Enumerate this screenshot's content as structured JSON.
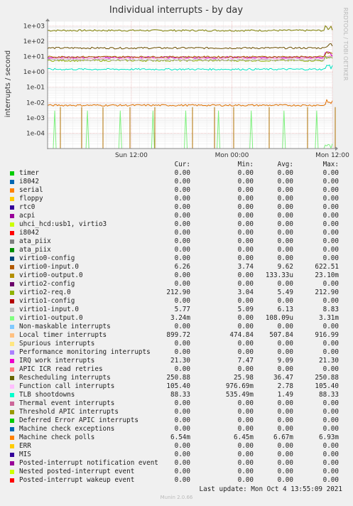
{
  "chart_data": {
    "type": "line",
    "title": "Individual interrupts - by day",
    "ylabel": "interrupts / second",
    "side_label": "RRDTOOL / TOBI OETIKER",
    "y_scale": "log",
    "ylim": [
      1e-05,
      2000
    ],
    "y_ticks": [
      "1e+03",
      "1e+02",
      "1e+01",
      "1e+00",
      "1e-01",
      "1e-02",
      "1e-03",
      "1e-04"
    ],
    "x_ticks": [
      "Sun 12:00",
      "Mon 00:00",
      "Mon 12:00"
    ],
    "grid": true,
    "series_shown": [
      {
        "name": "Local timer interrupts",
        "color": "#7e7e00",
        "value": 507.84
      },
      {
        "name": "Function call interrupts",
        "color": "#ff8fd3",
        "value": 7.78
      },
      {
        "name": "Rescheduling interrupts",
        "color": "#6b4e00",
        "value": 36.47
      },
      {
        "name": "IRQ work interrupts",
        "color": "#c000c0",
        "value": 9.09
      },
      {
        "name": "virtio2-req.0",
        "color": "#8fb000",
        "value": 5.49
      },
      {
        "name": "virtio1-input.0",
        "color": "#b0b0b0",
        "value": 6.13
      },
      {
        "name": "TLB shootdowns",
        "color": "#00e0c0",
        "value": 1.49
      },
      {
        "name": "Machine check polls",
        "color": "#e07000",
        "value": 0.00667
      },
      {
        "name": "virtio0-input.0",
        "color": "#b07000",
        "value": 9.62
      },
      {
        "name": "virtio1-output.0",
        "color": "#7ef07e",
        "value": 0.000108
      }
    ]
  },
  "legend": {
    "headers": {
      "cur": "Cur:",
      "min": "Min:",
      "avg": "Avg:",
      "max": "Max:"
    },
    "rows": [
      {
        "name": "timer",
        "color": "#00cc00",
        "cur": "0.00",
        "min": "0.00",
        "avg": "0.00",
        "max": "0.00"
      },
      {
        "name": "i8042",
        "color": "#0066b3",
        "cur": "0.00",
        "min": "0.00",
        "avg": "0.00",
        "max": "0.00"
      },
      {
        "name": "serial",
        "color": "#ff8000",
        "cur": "0.00",
        "min": "0.00",
        "avg": "0.00",
        "max": "0.00"
      },
      {
        "name": "floppy",
        "color": "#ffcc00",
        "cur": "0.00",
        "min": "0.00",
        "avg": "0.00",
        "max": "0.00"
      },
      {
        "name": "rtc0",
        "color": "#330099",
        "cur": "0.00",
        "min": "0.00",
        "avg": "0.00",
        "max": "0.00"
      },
      {
        "name": "acpi",
        "color": "#990099",
        "cur": "0.00",
        "min": "0.00",
        "avg": "0.00",
        "max": "0.00"
      },
      {
        "name": "uhci_hcd:usb1, virtio3",
        "color": "#ccff00",
        "cur": "0.00",
        "min": "0.00",
        "avg": "0.00",
        "max": "0.00"
      },
      {
        "name": "i8042",
        "color": "#ff0000",
        "cur": "0.00",
        "min": "0.00",
        "avg": "0.00",
        "max": "0.00"
      },
      {
        "name": "ata_piix",
        "color": "#808080",
        "cur": "0.00",
        "min": "0.00",
        "avg": "0.00",
        "max": "0.00"
      },
      {
        "name": "ata_piix",
        "color": "#008f00",
        "cur": "0.00",
        "min": "0.00",
        "avg": "0.00",
        "max": "0.00"
      },
      {
        "name": "virtio0-config",
        "color": "#00487d",
        "cur": "0.00",
        "min": "0.00",
        "avg": "0.00",
        "max": "0.00"
      },
      {
        "name": "virtio0-input.0",
        "color": "#b35a00",
        "cur": "6.26",
        "min": "3.74",
        "avg": "9.62",
        "max": "622.51"
      },
      {
        "name": "virtio0-output.0",
        "color": "#b38f00",
        "cur": "0.00",
        "min": "0.00",
        "avg": "133.33u",
        "max": "23.10m"
      },
      {
        "name": "virtio2-config",
        "color": "#6b006b",
        "cur": "0.00",
        "min": "0.00",
        "avg": "0.00",
        "max": "0.00"
      },
      {
        "name": "virtio2-req.0",
        "color": "#8fb300",
        "cur": "212.90",
        "min": "3.04",
        "avg": "5.49",
        "max": "212.90"
      },
      {
        "name": "virtio1-config",
        "color": "#b30000",
        "cur": "0.00",
        "min": "0.00",
        "avg": "0.00",
        "max": "0.00"
      },
      {
        "name": "virtio1-input.0",
        "color": "#bebebe",
        "cur": "5.77",
        "min": "5.09",
        "avg": "6.13",
        "max": "8.83"
      },
      {
        "name": "virtio1-output.0",
        "color": "#80ff80",
        "cur": "3.24m",
        "min": "0.00",
        "avg": "108.09u",
        "max": "3.31m"
      },
      {
        "name": "Non-maskable interrupts",
        "color": "#80c9ff",
        "cur": "0.00",
        "min": "0.00",
        "avg": "0.00",
        "max": "0.00"
      },
      {
        "name": "Local timer interrupts",
        "color": "#ffc080",
        "cur": "899.72",
        "min": "474.84",
        "avg": "507.84",
        "max": "916.99"
      },
      {
        "name": "Spurious interrupts",
        "color": "#ffe680",
        "cur": "0.00",
        "min": "0.00",
        "avg": "0.00",
        "max": "0.00"
      },
      {
        "name": "Performance monitoring interrupts",
        "color": "#aa80ff",
        "cur": "0.00",
        "min": "0.00",
        "avg": "0.00",
        "max": "0.00"
      },
      {
        "name": "IRQ work interrupts",
        "color": "#ee00cc",
        "cur": "21.30",
        "min": "7.47",
        "avg": "9.09",
        "max": "21.30"
      },
      {
        "name": "APIC ICR read retries",
        "color": "#ff8080",
        "cur": "0.00",
        "min": "0.00",
        "avg": "0.00",
        "max": "0.00"
      },
      {
        "name": "Rescheduling interrupts",
        "color": "#666600",
        "cur": "250.88",
        "min": "25.98",
        "avg": "36.47",
        "max": "250.88"
      },
      {
        "name": "Function call interrupts",
        "color": "#ffbfff",
        "cur": "105.40",
        "min": "976.69m",
        "avg": "2.78",
        "max": "105.40"
      },
      {
        "name": "TLB shootdowns",
        "color": "#00ffcc",
        "cur": "88.33",
        "min": "535.49m",
        "avg": "1.49",
        "max": "88.33"
      },
      {
        "name": "Thermal event interrupts",
        "color": "#cc6699",
        "cur": "0.00",
        "min": "0.00",
        "avg": "0.00",
        "max": "0.00"
      },
      {
        "name": "Threshold APIC interrupts",
        "color": "#999900",
        "cur": "0.00",
        "min": "0.00",
        "avg": "0.00",
        "max": "0.00"
      },
      {
        "name": "Deferred Error APIC interrupts",
        "color": "#00cc00",
        "cur": "0.00",
        "min": "0.00",
        "avg": "0.00",
        "max": "0.00"
      },
      {
        "name": "Machine check exceptions",
        "color": "#0066b3",
        "cur": "0.00",
        "min": "0.00",
        "avg": "0.00",
        "max": "0.00"
      },
      {
        "name": "Machine check polls",
        "color": "#ff8000",
        "cur": "6.54m",
        "min": "6.45m",
        "avg": "6.67m",
        "max": "6.93m"
      },
      {
        "name": "ERR",
        "color": "#ffcc00",
        "cur": "0.00",
        "min": "0.00",
        "avg": "0.00",
        "max": "0.00"
      },
      {
        "name": "MIS",
        "color": "#330099",
        "cur": "0.00",
        "min": "0.00",
        "avg": "0.00",
        "max": "0.00"
      },
      {
        "name": "Posted-interrupt notification event",
        "color": "#990099",
        "cur": "0.00",
        "min": "0.00",
        "avg": "0.00",
        "max": "0.00"
      },
      {
        "name": "Nested posted-interrupt event",
        "color": "#ccff00",
        "cur": "0.00",
        "min": "0.00",
        "avg": "0.00",
        "max": "0.00"
      },
      {
        "name": "Posted-interrupt wakeup event",
        "color": "#ff0000",
        "cur": "0.00",
        "min": "0.00",
        "avg": "0.00",
        "max": "0.00"
      }
    ]
  },
  "last_update": "Last update: Mon Oct  4 13:55:09 2021",
  "footer": "Munin 2.0.66"
}
